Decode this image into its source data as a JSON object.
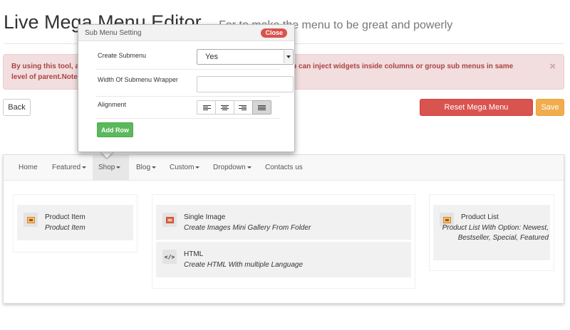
{
  "page": {
    "title": "Live Mega Menu Editor",
    "subtitle": "– For to make the menu to be great and powerly"
  },
  "alert": {
    "line1": "By using this tool, a                                                                                              mns. You can inject widgets inside columns or group sub menus in same",
    "line2": "level of parent.Note:                                                                                              verrided",
    "close": "×"
  },
  "actions": {
    "back": "Back",
    "reset": "Reset Mega Menu Configuration",
    "save": "Save"
  },
  "nav": {
    "items": [
      {
        "label": "Home",
        "caret": false,
        "active": false
      },
      {
        "label": "Featured",
        "caret": true,
        "active": false
      },
      {
        "label": "Shop",
        "caret": true,
        "active": true
      },
      {
        "label": "Blog",
        "caret": true,
        "active": false
      },
      {
        "label": "Custom",
        "caret": true,
        "active": false
      },
      {
        "label": "Dropdown",
        "caret": true,
        "active": false
      },
      {
        "label": "Contacts us",
        "caret": false,
        "active": false
      }
    ]
  },
  "widgets": {
    "col1": [
      {
        "title": "Product Item",
        "desc": "Product Item",
        "icon": "image-icon"
      }
    ],
    "col2": [
      {
        "title": "Single Image",
        "desc": "Create Images Mini Gallery From Folder",
        "icon": "image-icon"
      },
      {
        "title": "HTML",
        "desc": "Create HTML With multiple Language",
        "icon": "code-icon"
      }
    ],
    "col3": [
      {
        "title": "Product List",
        "desc": "Product List With Option: Newest, Bestseller, Special, Featured",
        "icon": "image-icon"
      }
    ]
  },
  "popup": {
    "title": "Sub Menu Setting",
    "close": "Close",
    "create_submenu_label": "Create Submenu",
    "create_submenu_value": "Yes",
    "width_label": "Width Of Submenu Wrapper",
    "width_value": "",
    "alignment_label": "Alignment",
    "alignment_options": [
      "left",
      "center",
      "right",
      "justify"
    ],
    "alignment_selected": "justify",
    "add_row": "Add Row"
  },
  "colors": {
    "danger": "#d9534f",
    "warning": "#f0ad4e",
    "success": "#5cb85c",
    "alert_bg": "#f2dede",
    "alert_text": "#a94442"
  }
}
